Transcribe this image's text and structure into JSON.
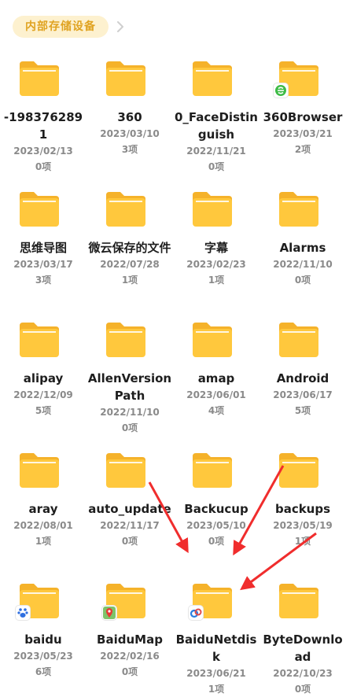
{
  "breadcrumb": {
    "current": "内部存储设备"
  },
  "folders": [
    {
      "name": "-1983762891",
      "date": "2023/02/13",
      "count": "0项",
      "badge": ""
    },
    {
      "name": "360",
      "date": "2023/03/10",
      "count": "3项",
      "badge": ""
    },
    {
      "name": "0_FaceDistinguish",
      "date": "2022/11/21",
      "count": "0项",
      "badge": ""
    },
    {
      "name": "360Browser",
      "date": "2023/03/21",
      "count": "2项",
      "badge": "360-browser-icon"
    },
    {
      "name": "思维导图",
      "date": "2023/03/17",
      "count": "3项",
      "badge": ""
    },
    {
      "name": "微云保存的文件",
      "date": "2022/07/28",
      "count": "1项",
      "badge": ""
    },
    {
      "name": "字幕",
      "date": "2023/02/23",
      "count": "1项",
      "badge": ""
    },
    {
      "name": "Alarms",
      "date": "2022/11/10",
      "count": "0项",
      "badge": ""
    },
    {
      "name": "alipay",
      "date": "2022/12/09",
      "count": "5项",
      "badge": ""
    },
    {
      "name": "AllenVersionPath",
      "date": "2022/11/10",
      "count": "0项",
      "badge": ""
    },
    {
      "name": "amap",
      "date": "2023/06/01",
      "count": "4项",
      "badge": ""
    },
    {
      "name": "Android",
      "date": "2023/06/17",
      "count": "5项",
      "badge": ""
    },
    {
      "name": "aray",
      "date": "2022/08/01",
      "count": "1项",
      "badge": ""
    },
    {
      "name": "auto_update",
      "date": "2022/11/17",
      "count": "0项",
      "badge": ""
    },
    {
      "name": "Backucup",
      "date": "2023/05/10",
      "count": "0项",
      "badge": ""
    },
    {
      "name": "backups",
      "date": "2023/05/19",
      "count": "1项",
      "badge": ""
    },
    {
      "name": "baidu",
      "date": "2023/05/23",
      "count": "6项",
      "badge": "baidu-paw-icon"
    },
    {
      "name": "BaiduMap",
      "date": "2022/02/16",
      "count": "0项",
      "badge": "baidumap-pin-icon"
    },
    {
      "name": "BaiduNetdisk",
      "date": "2023/06/21",
      "count": "1项",
      "badge": "baidunetdisk-icon"
    },
    {
      "name": "ByteDownload",
      "date": "2022/10/23",
      "count": "0项",
      "badge": ""
    }
  ],
  "colors": {
    "folder_body": "#ffc83d",
    "folder_tab": "#f5b22a",
    "arrow": "#f02d2d",
    "crumb_bg": "#fdf1cf",
    "crumb_text": "#e0a321"
  }
}
